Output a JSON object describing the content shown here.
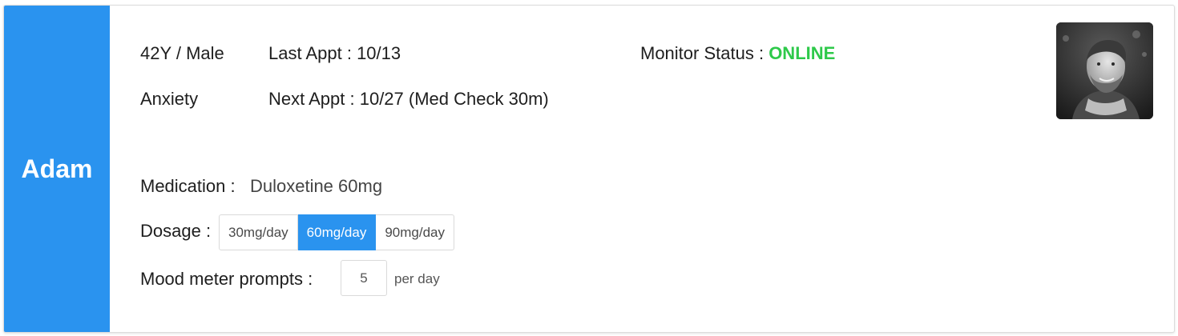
{
  "patient": {
    "name": "Adam",
    "age_sex": "42Y / Male",
    "condition": "Anxiety",
    "photo_icon": "patient-photo"
  },
  "appointments": {
    "last": "Last Appt : 10/13",
    "next": "Next Appt : 10/27 (Med Check 30m)"
  },
  "monitor": {
    "label": "Monitor Status : ",
    "status": "ONLINE",
    "status_color": "#2ec94a"
  },
  "medication": {
    "label": "Medication :",
    "value": "Duloxetine 60mg"
  },
  "dosage": {
    "label": "Dosage :",
    "options": [
      "30mg/day",
      "60mg/day",
      "90mg/day"
    ],
    "selected": "60mg/day"
  },
  "mood": {
    "label": "Mood meter prompts :",
    "value": "5",
    "unit": "per day"
  },
  "colors": {
    "accent": "#2a93ef",
    "online": "#2ec94a"
  }
}
